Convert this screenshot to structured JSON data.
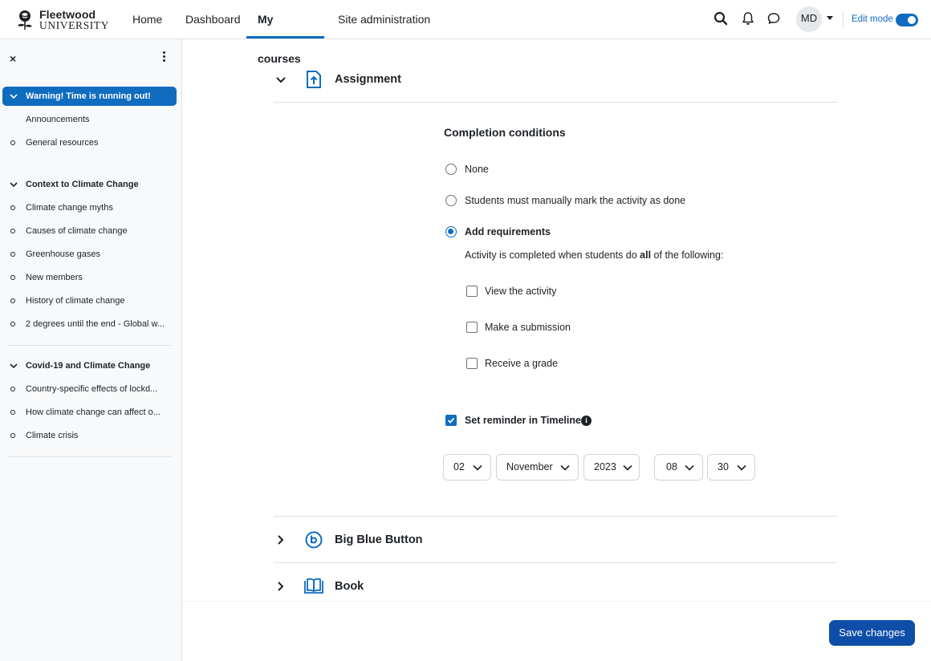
{
  "brand": {
    "line1": "Fleetwood",
    "line2": "UNIVERSITY",
    "logo": "rose-logo"
  },
  "nav": {
    "items": [
      "Home",
      "Dashboard",
      "My courses",
      "Site administration"
    ],
    "active": "My courses"
  },
  "header_actions": {
    "search": "search-icon",
    "notifications": "bell-icon",
    "messages": "chat-icon",
    "avatar_initials": "MD",
    "edit_mode_label": "Edit mode",
    "edit_mode_on": true
  },
  "drawer": {
    "close": "×",
    "sections": [
      {
        "title": "Warning! Time is running out!",
        "active": true,
        "items": [
          "Announcements",
          "General resources"
        ]
      },
      {
        "title": "Context to Climate Change",
        "items": [
          "Climate change myths",
          "Causes of climate change",
          "Greenhouse gases",
          "New members",
          "History of climate change",
          "2 degrees until the end - Global w..."
        ]
      },
      {
        "title": "Covid-19 and Climate Change",
        "items": [
          "Country-specific effects of lockd...",
          "How climate change can affect o...",
          "Climate crisis"
        ]
      }
    ]
  },
  "activities": [
    {
      "title": "Assignment",
      "icon": "assignment-upload-icon",
      "expanded": true
    },
    {
      "title": "Big Blue Button",
      "icon": "bigbluebutton-icon",
      "expanded": false
    },
    {
      "title": "Book",
      "icon": "book-icon",
      "expanded": false
    }
  ],
  "completion": {
    "title": "Completion conditions",
    "options": [
      "None",
      "Students must manually mark the activity as done",
      "Add requirements"
    ],
    "selected": "Add requirements",
    "help_pre": "Activity is completed when students do ",
    "help_bold": "all",
    "help_post": " of the following:",
    "requirements": [
      {
        "label": "View the activity",
        "checked": false
      },
      {
        "label": "Make a submission",
        "checked": false
      },
      {
        "label": "Receive a grade",
        "checked": false
      }
    ],
    "reminder": {
      "label": "Set reminder in Timeline",
      "checked": true,
      "info_icon": "info-icon"
    },
    "date": {
      "day": "02",
      "month": "November",
      "year": "2023",
      "hour": "08",
      "minute": "30"
    }
  },
  "footer": {
    "save_label": "Save changes"
  },
  "colors": {
    "primary": "#0f6cbf",
    "save_button": "#0f4ea8",
    "drawer_bg": "#f8f9fa"
  }
}
